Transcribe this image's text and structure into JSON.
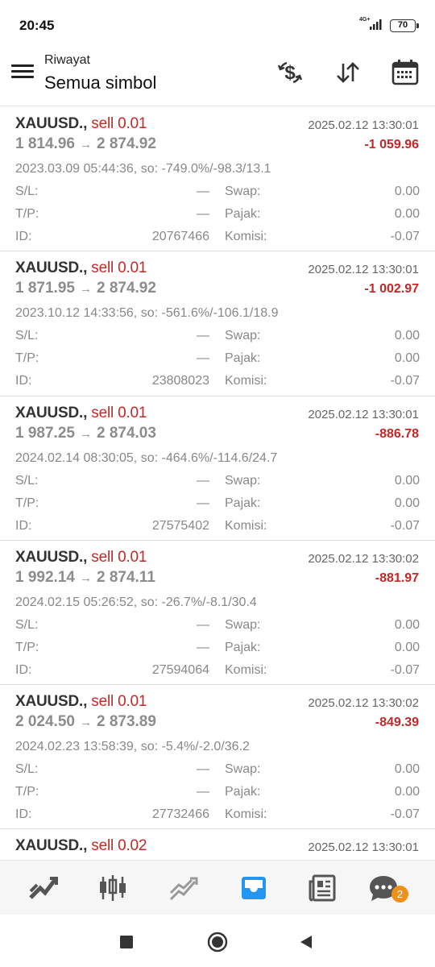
{
  "status": {
    "time": "20:45",
    "network": "4G+",
    "battery": "70"
  },
  "header": {
    "subtitle": "Riwayat",
    "title": "Semua simbol",
    "icons": [
      "dollar-exchange-icon",
      "sort-icon",
      "calendar-icon"
    ]
  },
  "labels": {
    "sl": "S/L:",
    "tp": "T/P:",
    "id": "ID:",
    "swap": "Swap:",
    "pajak": "Pajak:",
    "komisi": "Komisi:",
    "arrow": "→"
  },
  "trades": [
    {
      "symbol": "XAUUSD.,",
      "side": "sell 0.01",
      "close_time": "2025.02.12 13:30:01",
      "open_price": "1 814.96",
      "close_price": "2 874.92",
      "profit": "-1 059.96",
      "info": "2023.03.09 05:44:36, so: -749.0%/-98.3/13.1",
      "sl": "—",
      "tp": "—",
      "id": "20767466",
      "swap": "0.00",
      "pajak": "0.00",
      "komisi": "-0.07"
    },
    {
      "symbol": "XAUUSD.,",
      "side": "sell 0.01",
      "close_time": "2025.02.12 13:30:01",
      "open_price": "1 871.95",
      "close_price": "2 874.92",
      "profit": "-1 002.97",
      "info": "2023.10.12 14:33:56, so: -561.6%/-106.1/18.9",
      "sl": "—",
      "tp": "—",
      "id": "23808023",
      "swap": "0.00",
      "pajak": "0.00",
      "komisi": "-0.07"
    },
    {
      "symbol": "XAUUSD.,",
      "side": "sell 0.01",
      "close_time": "2025.02.12 13:30:01",
      "open_price": "1 987.25",
      "close_price": "2 874.03",
      "profit": "-886.78",
      "info": "2024.02.14 08:30:05, so: -464.6%/-114.6/24.7",
      "sl": "—",
      "tp": "—",
      "id": "27575402",
      "swap": "0.00",
      "pajak": "0.00",
      "komisi": "-0.07"
    },
    {
      "symbol": "XAUUSD.,",
      "side": "sell 0.01",
      "close_time": "2025.02.12 13:30:02",
      "open_price": "1 992.14",
      "close_price": "2 874.11",
      "profit": "-881.97",
      "info": "2024.02.15 05:26:52, so: -26.7%/-8.1/30.4",
      "sl": "—",
      "tp": "—",
      "id": "27594064",
      "swap": "0.00",
      "pajak": "0.00",
      "komisi": "-0.07"
    },
    {
      "symbol": "XAUUSD.,",
      "side": "sell 0.01",
      "close_time": "2025.02.12 13:30:02",
      "open_price": "2 024.50",
      "close_price": "2 873.89",
      "profit": "-849.39",
      "info": "2024.02.23 13:58:39, so: -5.4%/-2.0/36.2",
      "sl": "—",
      "tp": "—",
      "id": "27732466",
      "swap": "0.00",
      "pajak": "0.00",
      "komisi": "-0.07"
    },
    {
      "symbol": "XAUUSD.,",
      "side": "sell 0.02",
      "close_time": "2025.02.12 13:30:01"
    }
  ],
  "bottom_nav": {
    "items": [
      "quotes-arrows-icon",
      "chart-candles-icon",
      "trade-trend-icon",
      "history-inbox-icon",
      "news-icon",
      "chat-icon"
    ],
    "active": "history-inbox-icon",
    "active_color": "#2196f3",
    "chat_badge": "2"
  },
  "colors": {
    "loss": "#c62828",
    "badge": "#f0901c"
  }
}
